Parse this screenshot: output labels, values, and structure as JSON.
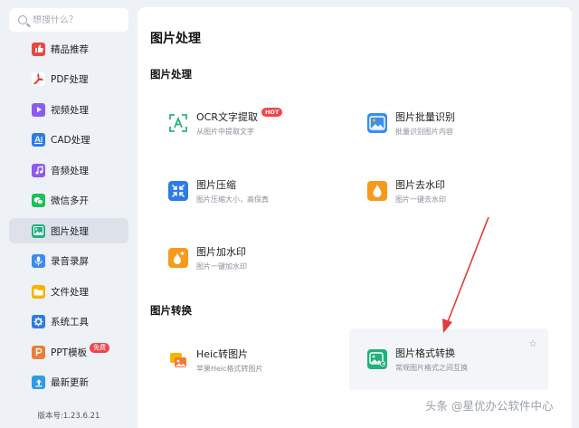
{
  "search": {
    "placeholder": "想搜什么？"
  },
  "sidebar": {
    "items": [
      {
        "label": "精品推荐",
        "icon": "thumbs-up-icon",
        "color": "#e8483e"
      },
      {
        "label": "PDF处理",
        "icon": "pdf-icon",
        "color": "#ffffff"
      },
      {
        "label": "视频处理",
        "icon": "video-icon",
        "color": "#8c5cf0"
      },
      {
        "label": "CAD处理",
        "icon": "cad-icon",
        "color": "#2f7be5"
      },
      {
        "label": "音频处理",
        "icon": "music-icon",
        "color": "#8c5cf0"
      },
      {
        "label": "微信多开",
        "icon": "wechat-icon",
        "color": "#1fbf5b"
      },
      {
        "label": "图片处理",
        "icon": "image-icon",
        "color": "#22b07d",
        "active": true
      },
      {
        "label": "录音录屏",
        "icon": "microphone-icon",
        "color": "#3d8bf0"
      },
      {
        "label": "文件处理",
        "icon": "folder-icon",
        "color": "#f5b400"
      },
      {
        "label": "系统工具",
        "icon": "gear-icon",
        "color": "#2f7be5"
      },
      {
        "label": "PPT模板",
        "icon": "ppt-icon",
        "color": "#f07a3a",
        "badge": "免费"
      },
      {
        "label": "最新更新",
        "icon": "upload-icon",
        "color": "#2f9be5"
      }
    ],
    "version": "版本号:1.23.6.21"
  },
  "main": {
    "title": "图片处理",
    "section1": "图片处理",
    "section2": "图片转换",
    "tools": [
      {
        "name": "OCR文字提取",
        "desc": "从图片中提取文字",
        "icon": "ocr-icon",
        "badge": "HOT"
      },
      {
        "name": "图片批量识别",
        "desc": "批量识别图片内容",
        "icon": "image-recognition-icon"
      },
      {
        "name": "图片压缩",
        "desc": "图片压缩大小，高保真",
        "icon": "compress-icon"
      },
      {
        "name": "图片去水印",
        "desc": "图片一键去水印",
        "icon": "remove-watermark-icon"
      },
      {
        "name": "图片加水印",
        "desc": "图片一键加水印",
        "icon": "add-watermark-icon"
      },
      {
        "name": "Heic转图片",
        "desc": "苹果Heic格式转图片",
        "icon": "heic-icon"
      },
      {
        "name": "图片格式转换",
        "desc": "常规图片格式之间互换",
        "icon": "format-convert-icon"
      }
    ],
    "star": "☆"
  },
  "watermark": "头条 @星优办公软件中心",
  "colors": {
    "accent_red": "#e23b3b",
    "active_bg": "#dde2ea",
    "page_bg": "#eef1f6"
  }
}
